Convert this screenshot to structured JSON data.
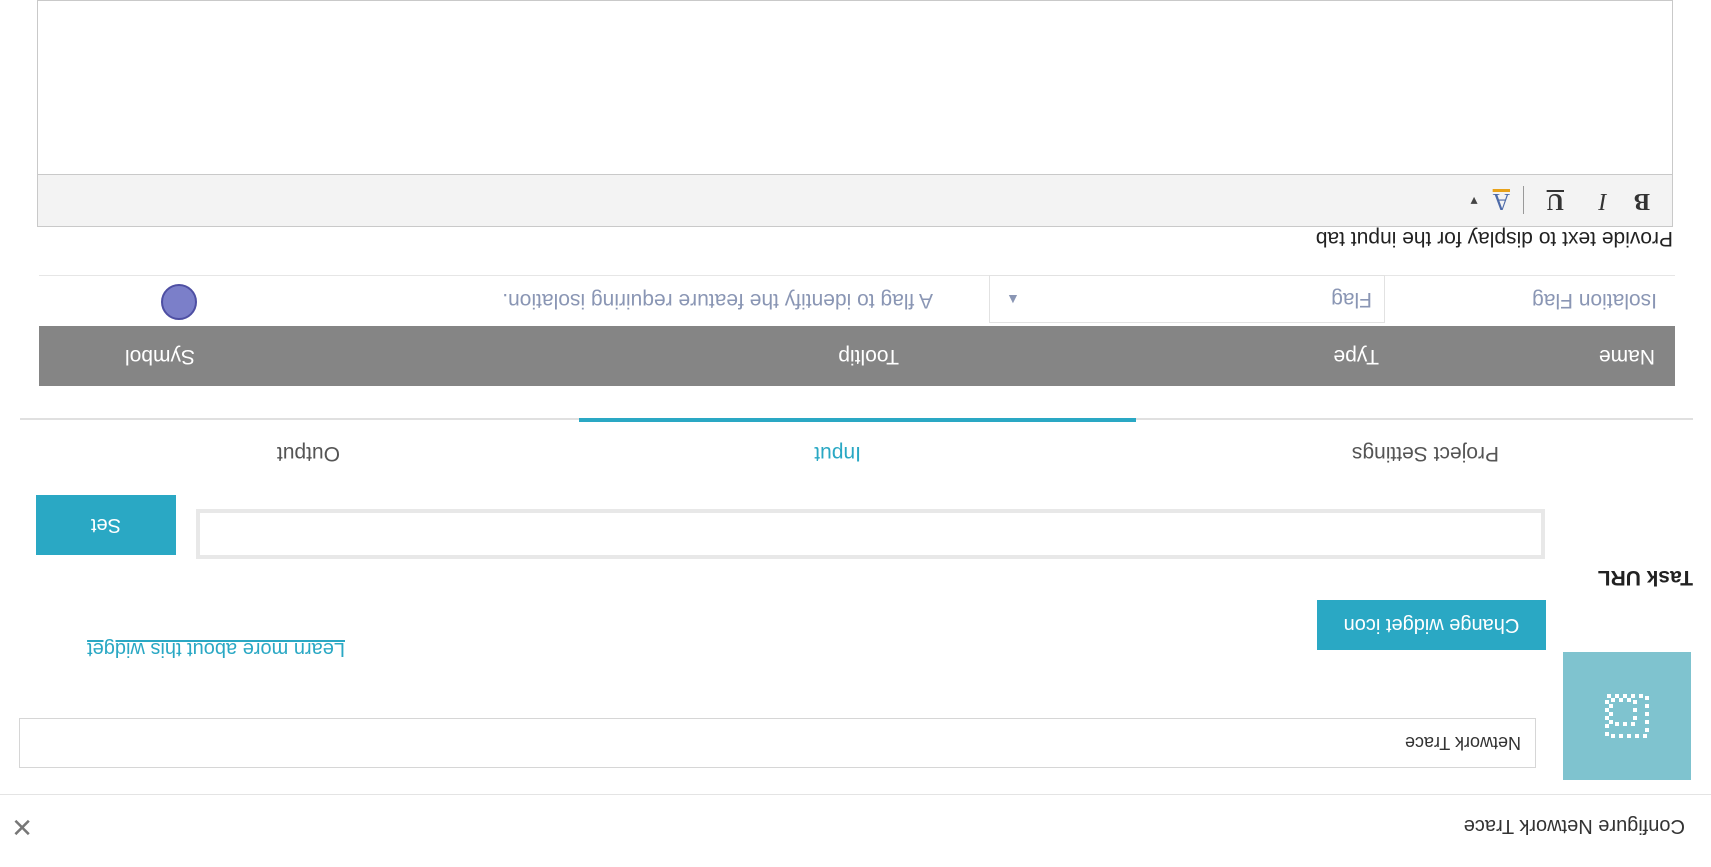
{
  "dialog": {
    "title": "Configure Network Trace"
  },
  "widget": {
    "name_value": "Network Trace",
    "change_icon_label": "Change widget icon",
    "learn_more_label": "Learn more about this widget"
  },
  "task_url": {
    "label": "Task URL",
    "value": "",
    "set_label": "Set"
  },
  "tabs": [
    {
      "label": "Project Settings",
      "active": false
    },
    {
      "label": "Input",
      "active": true
    },
    {
      "label": "Output",
      "active": false
    }
  ],
  "input_table": {
    "headers": [
      "Name",
      "Type",
      "Tooltip",
      "Symbol"
    ],
    "rows": [
      {
        "name": "Isolation Flag",
        "type": "Flag",
        "tooltip": "A flag to identify the feature requiring isolation.",
        "symbol_color": "#7b7fc9"
      }
    ]
  },
  "description": {
    "label": "Provide text to display for the input tab",
    "toolbar": {
      "bold": "B",
      "italic": "I",
      "underline": "U",
      "font_color": "A"
    },
    "content": ""
  },
  "colors": {
    "accent": "#2aa8c4",
    "icon_bg": "#7fc3cf",
    "table_header": "#858585"
  }
}
